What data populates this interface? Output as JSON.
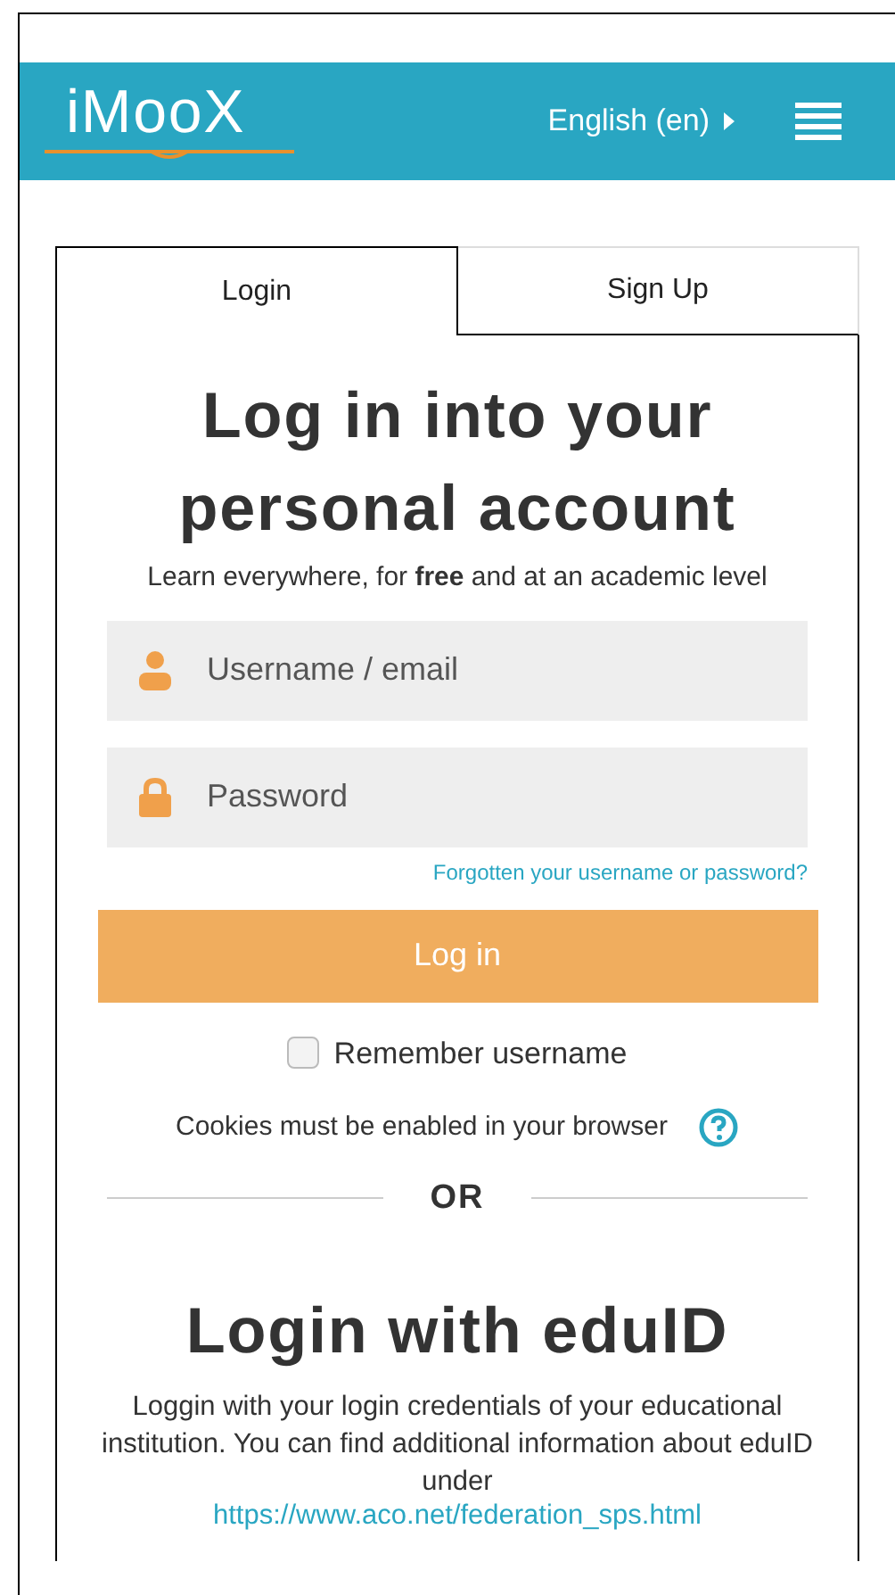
{
  "header": {
    "logo": "iMooX",
    "language": "English (en)"
  },
  "tabs": [
    {
      "label": "Login",
      "selected": true
    },
    {
      "label": "Sign Up",
      "selected": false
    }
  ],
  "login": {
    "title": "Log in into your personal account",
    "subtitle": "Learn everywhere, for **free** and at an academic level",
    "fields": [
      {
        "kind": "user",
        "placeholder": "Username / email"
      },
      {
        "kind": "lock",
        "placeholder": "Password"
      }
    ],
    "forgot_link": "Forgotten your username or password?",
    "button": "Log in",
    "remember": {
      "label": "Remember username",
      "checked": false
    },
    "cookies_note": "Cookies must be enabled in your browser",
    "divider": "OR"
  },
  "eduid": {
    "title": "Login with eduID",
    "text": "Loggin with your login credentials of your educational institution. You can find additional information about eduID under",
    "link": "https://www.aco.net/federation_sps.html"
  }
}
